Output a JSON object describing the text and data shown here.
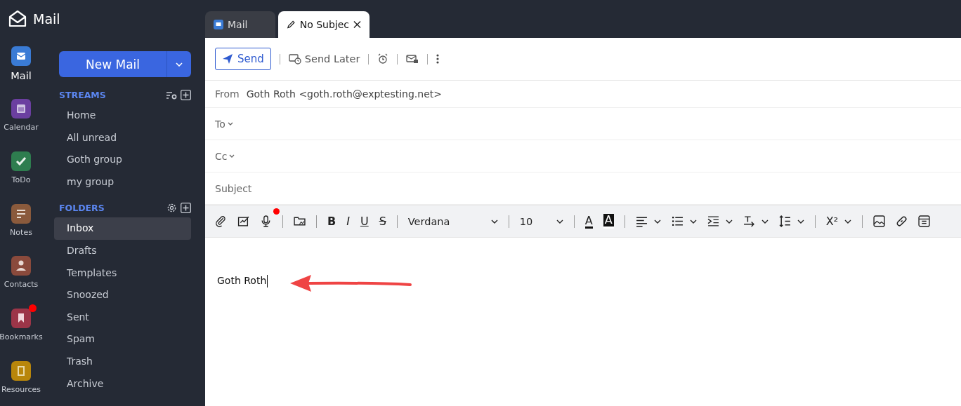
{
  "app": {
    "title": "Mail"
  },
  "rail": [
    {
      "kind": "mail",
      "label": "Mail",
      "color": "#3a7bd5",
      "selected": true,
      "badge": false
    },
    {
      "kind": "calendar",
      "label": "Calendar",
      "color": "#6b3fa0",
      "selected": false,
      "badge": false
    },
    {
      "kind": "todo",
      "label": "ToDo",
      "color": "#2e7d4f",
      "selected": false,
      "badge": false
    },
    {
      "kind": "notes",
      "label": "Notes",
      "color": "#8a5a3c",
      "selected": false,
      "badge": false
    },
    {
      "kind": "contacts",
      "label": "Contacts",
      "color": "#8a4a3c",
      "selected": false,
      "badge": false
    },
    {
      "kind": "bookmarks",
      "label": "Bookmarks",
      "color": "#9c3548",
      "selected": false,
      "badge": true
    },
    {
      "kind": "resources",
      "label": "Resources",
      "color": "#b8860b",
      "selected": false,
      "badge": false
    }
  ],
  "new_mail": {
    "label": "New Mail"
  },
  "streams": {
    "title": "STREAMS",
    "items": [
      {
        "label": "Home",
        "selected": false
      },
      {
        "label": "All unread",
        "selected": false
      },
      {
        "label": "Goth group",
        "selected": false
      },
      {
        "label": "my group",
        "selected": false
      }
    ]
  },
  "folders": {
    "title": "FOLDERS",
    "items": [
      {
        "label": "Inbox",
        "selected": true
      },
      {
        "label": "Drafts",
        "selected": false
      },
      {
        "label": "Templates",
        "selected": false
      },
      {
        "label": "Snoozed",
        "selected": false
      },
      {
        "label": "Sent",
        "selected": false
      },
      {
        "label": "Spam",
        "selected": false
      },
      {
        "label": "Trash",
        "selected": false
      },
      {
        "label": "Archive",
        "selected": false
      }
    ]
  },
  "tabs": [
    {
      "kind": "mail",
      "label": "Mail",
      "selected": false
    },
    {
      "kind": "compose",
      "label": "No Subjec",
      "selected": true
    }
  ],
  "toolbar": {
    "send": "Send",
    "send_later": "Send Later"
  },
  "compose": {
    "from_label": "From",
    "from_value": "Goth Roth <goth.roth@exptesting.net>",
    "to_label": "To",
    "cc_label": "Cc",
    "subject_placeholder": "Subject"
  },
  "editor": {
    "bold": "B",
    "italic": "I",
    "underline": "U",
    "strike": "S",
    "font": "Verdana",
    "size": "10",
    "text_color": "A",
    "highlight": "A",
    "superscript": "X²",
    "recording": true
  },
  "body": {
    "text": "Goth Roth"
  }
}
